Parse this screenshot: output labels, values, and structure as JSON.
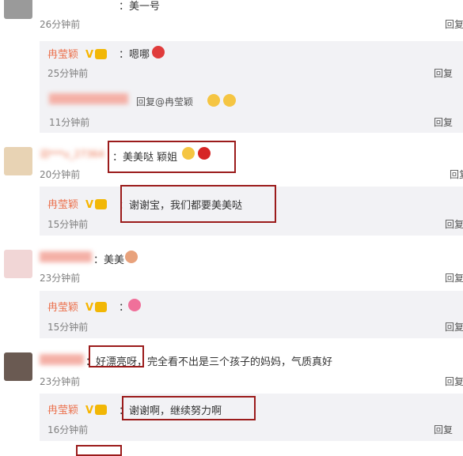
{
  "author_nick": "冉莹颖",
  "reply_label": "回复",
  "comments": [
    {
      "text": "：美一号",
      "time": "26分钟前"
    },
    {
      "text": "：嗯哪",
      "time": "25分钟前"
    },
    {
      "text": "回复@冉莹颖",
      "time": "11分钟前"
    },
    {
      "user": "汨***u_27364",
      "text": "：美美哒 颖姐",
      "time": "20分钟前"
    },
    {
      "text": "：谢谢宝，我们都要美美哒",
      "time": "15分钟前"
    },
    {
      "text": "：美美",
      "time": "23分钟前"
    },
    {
      "text": "：",
      "time": "15分钟前"
    },
    {
      "text": "：好漂亮呀，完全看不出是三个孩子的妈妈，气质真好",
      "time": "23分钟前"
    },
    {
      "text": "：谢谢啊，继续努力啊",
      "time": "16分钟前"
    }
  ],
  "colors": {
    "nick": "#eb7350",
    "highlight": "#9b1b1b",
    "sub_bg": "#f2f2f5"
  }
}
